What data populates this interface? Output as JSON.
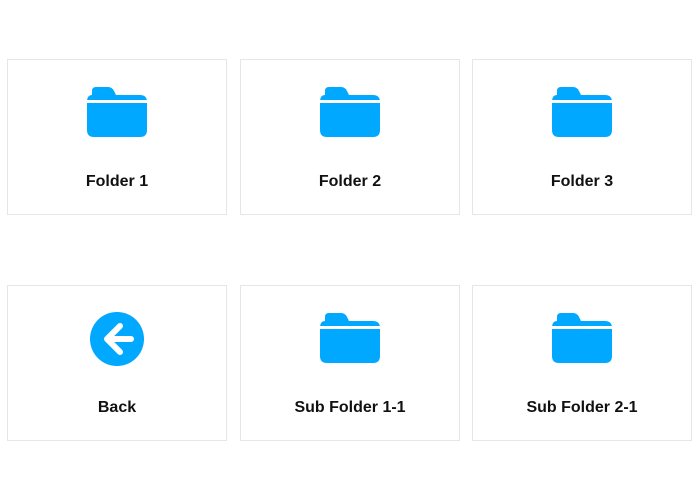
{
  "accent_color": "#00a8ff",
  "tiles": [
    {
      "label": "Folder 1",
      "icon": "folder-icon"
    },
    {
      "label": "Folder 2",
      "icon": "folder-icon"
    },
    {
      "label": "Folder 3",
      "icon": "folder-icon"
    },
    {
      "label": "Back",
      "icon": "back-arrow-icon"
    },
    {
      "label": "Sub Folder 1-1",
      "icon": "folder-icon"
    },
    {
      "label": "Sub Folder 2-1",
      "icon": "folder-icon"
    }
  ]
}
